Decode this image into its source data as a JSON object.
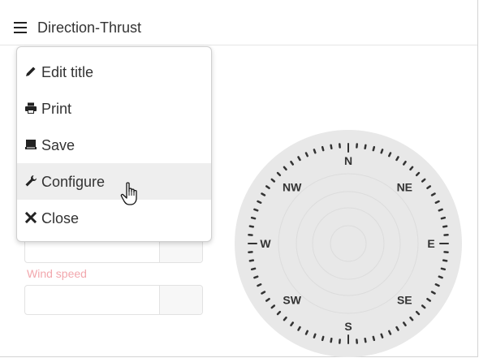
{
  "header": {
    "title": "Direction-Thrust",
    "menu_icon": "hamburger-icon"
  },
  "menu": {
    "items": [
      {
        "label": "Edit title",
        "icon": "pencil-icon"
      },
      {
        "label": "Print",
        "icon": "printer-icon"
      },
      {
        "label": "Save",
        "icon": "save-icon"
      },
      {
        "label": "Configure",
        "icon": "wrench-icon",
        "hovered": true
      },
      {
        "label": "Close",
        "icon": "close-icon"
      }
    ]
  },
  "form": {
    "wind_speed_label": "Wind speed",
    "label_color": "#f2a7ad"
  },
  "compass": {
    "directions": [
      "N",
      "NE",
      "E",
      "SE",
      "S",
      "SW",
      "W",
      "NW"
    ],
    "face_color": "#e8e8e8",
    "tick_color": "#333333"
  }
}
